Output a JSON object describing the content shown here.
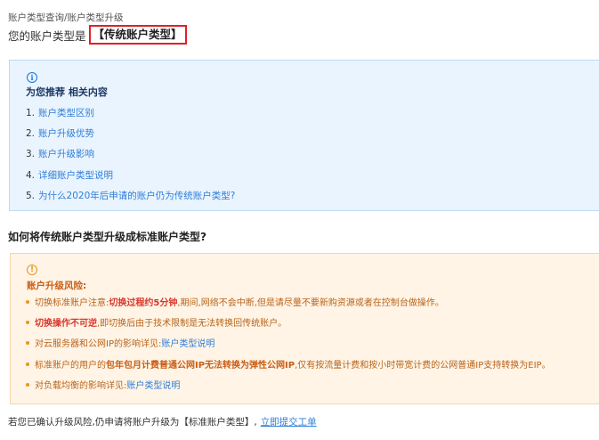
{
  "breadcrumb": "账户类型查询/账户类型升级",
  "account": {
    "label": "您的账户类型是",
    "type": "【传统账户类型】"
  },
  "recommend": {
    "icon": "info-icon",
    "title": "为您推荐 相关内容",
    "items": [
      {
        "num": "1.",
        "text": "账户类型区别"
      },
      {
        "num": "2.",
        "text": "账户升级优势"
      },
      {
        "num": "3.",
        "text": "账户升级影响"
      },
      {
        "num": "4.",
        "text": "详细账户类型说明"
      },
      {
        "num": "5.",
        "text": "为什么2020年后申请的账户仍为传统账户类型?"
      }
    ]
  },
  "section_heading": "如何将传统账户类型升级成标准账户类型?",
  "risk": {
    "icon": "warning-icon",
    "title": "账户升级风险:",
    "items": [
      {
        "a": "切换标准账户注意:",
        "b": "切换过程约5分钟",
        "c": ",期间,网络不会中断,但是请尽量不要新购资源或者在控制台做操作。"
      },
      {
        "a": "",
        "b": "切换操作不可逆",
        "c": ",即切换后由于技术限制是无法转换回传统账户。"
      },
      {
        "a": "对云服务器和公网IP的影响详见:",
        "link": "账户类型说明"
      },
      {
        "a": "标准账户的用户的",
        "b": "包年包月计费普通公网IP无法转换为弹性公网IP",
        "c": ",仅有按流量计费和按小时带宽计费的公网普通IP支持转换为EIP。"
      },
      {
        "a": "对负载均衡的影响详见:",
        "link": "账户类型说明"
      }
    ]
  },
  "footer": {
    "text": "若您已确认升级风险,仍申请将账户升级为【标准账户类型】,",
    "link": "立即提交工单"
  },
  "colors": {
    "info_bg": "#eaf4fe",
    "info_border": "#bcdaf6",
    "warn_bg": "#fff4e5",
    "warn_border": "#f6d6a6",
    "link": "#2f7ed8",
    "highlight_border": "#e0202a"
  }
}
